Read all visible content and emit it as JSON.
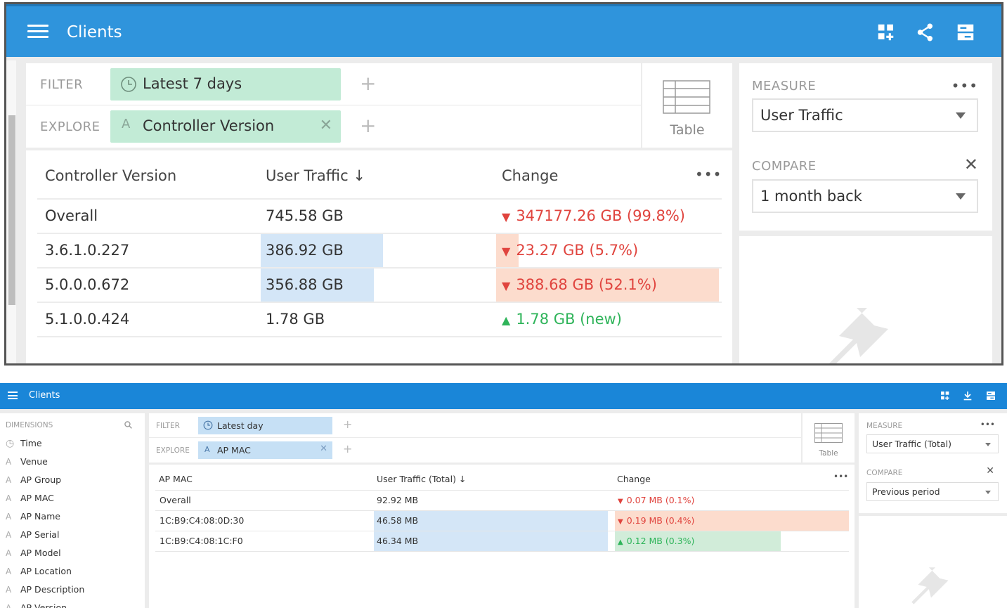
{
  "colors": {
    "header": "#2f94dc",
    "header_small": "#1a86d8",
    "filter_chip_top": "#c2ebd6",
    "filter_chip_bottom": "#c6e0f5",
    "bar_blue": "#d4e6f7",
    "bar_red": "#fcdccd",
    "bar_green": "#d1ecd9",
    "decrease": "#e0443e",
    "increase": "#2fb45a"
  },
  "top": {
    "header": {
      "title": "Clients",
      "icons": [
        "menu-icon",
        "add-tile-icon",
        "share-icon",
        "layout-icon"
      ]
    },
    "filter": {
      "label": "FILTER",
      "chip": "Latest 7 days",
      "chip_icon": "clock-icon"
    },
    "explore": {
      "label": "EXPLORE",
      "chip": "Controller Version",
      "chip_icon": "string-dimension-icon"
    },
    "viz": {
      "label": "Table"
    },
    "grid": {
      "columns": [
        "Controller Version",
        "User Traffic",
        "Change"
      ],
      "sort_indicator": "↓",
      "rows": [
        {
          "name": "Overall",
          "traffic": "745.58 GB",
          "traffic_share": 0,
          "change": "347177.26 GB (99.8%)",
          "direction": "down",
          "change_share": 0
        },
        {
          "name": "3.6.1.0.227",
          "traffic": "386.92 GB",
          "traffic_share": 0.52,
          "change": "23.27 GB (5.7%)",
          "direction": "down",
          "change_share": 0.1
        },
        {
          "name": "5.0.0.0.672",
          "traffic": "356.88 GB",
          "traffic_share": 0.48,
          "change": "388.68 GB (52.1%)",
          "direction": "down",
          "change_share": 1.0
        },
        {
          "name": "5.1.0.0.424",
          "traffic": "1.78 GB",
          "traffic_share": 0.0,
          "change": "1.78 GB (new)",
          "direction": "up",
          "change_share": 0
        }
      ]
    },
    "measure": {
      "label": "MEASURE",
      "value": "User Traffic"
    },
    "compare": {
      "label": "COMPARE",
      "value": "1 month back"
    }
  },
  "bottom": {
    "header": {
      "title": "Clients",
      "icons": [
        "menu-icon",
        "add-tile-icon",
        "download-icon",
        "layout-icon"
      ]
    },
    "dimensions": {
      "label": "DIMENSIONS",
      "items": [
        {
          "label": "Time",
          "icon": "clock-icon"
        },
        {
          "label": "Venue",
          "icon": "string-dimension-icon"
        },
        {
          "label": "AP Group",
          "icon": "string-dimension-icon"
        },
        {
          "label": "AP MAC",
          "icon": "string-dimension-icon"
        },
        {
          "label": "AP Name",
          "icon": "string-dimension-icon"
        },
        {
          "label": "AP Serial",
          "icon": "string-dimension-icon"
        },
        {
          "label": "AP Model",
          "icon": "string-dimension-icon"
        },
        {
          "label": "AP Location",
          "icon": "string-dimension-icon"
        },
        {
          "label": "AP Description",
          "icon": "string-dimension-icon"
        },
        {
          "label": "AP Version",
          "icon": "string-dimension-icon"
        }
      ]
    },
    "filter": {
      "label": "FILTER",
      "chip": "Latest day",
      "chip_icon": "clock-icon"
    },
    "explore": {
      "label": "EXPLORE",
      "chip": "AP MAC",
      "chip_icon": "string-dimension-icon"
    },
    "viz": {
      "label": "Table"
    },
    "grid": {
      "columns": [
        "AP MAC",
        "User Traffic (Total)",
        "Change"
      ],
      "sort_indicator": "↓",
      "rows": [
        {
          "name": "Overall",
          "traffic": "92.92 MB",
          "traffic_share": 0,
          "change": "0.07 MB (0.1%)",
          "direction": "down",
          "change_share": 0
        },
        {
          "name": "1C:B9:C4:08:0D:30",
          "traffic": "46.58 MB",
          "traffic_share": 0.5,
          "change": "0.19 MB (0.4%)",
          "direction": "down",
          "change_share": 1.0
        },
        {
          "name": "1C:B9:C4:08:1C:F0",
          "traffic": "46.34 MB",
          "traffic_share": 0.5,
          "change": "0.12 MB (0.3%)",
          "direction": "up",
          "change_share": 0.71
        }
      ]
    },
    "measure": {
      "label": "MEASURE",
      "value": "User Traffic (Total)"
    },
    "compare": {
      "label": "COMPARE",
      "value": "Previous period"
    }
  }
}
